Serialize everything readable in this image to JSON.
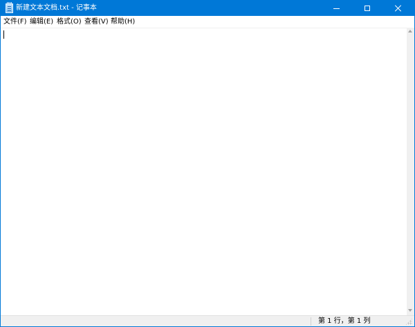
{
  "window": {
    "title": "新建文本文档.txt - 记事本",
    "accent_color": "#0078d7",
    "icon": "notepad-icon"
  },
  "caption_buttons": {
    "minimize_icon": "minimize-icon",
    "maximize_icon": "maximize-icon",
    "close_icon": "close-icon"
  },
  "menu": {
    "items": [
      {
        "label": "文件(F)"
      },
      {
        "label": "编辑(E)"
      },
      {
        "label": "格式(O)"
      },
      {
        "label": "查看(V)"
      },
      {
        "label": "帮助(H)"
      }
    ]
  },
  "editor": {
    "content": ""
  },
  "statusbar": {
    "position": "第 1 行，第 1 列"
  }
}
